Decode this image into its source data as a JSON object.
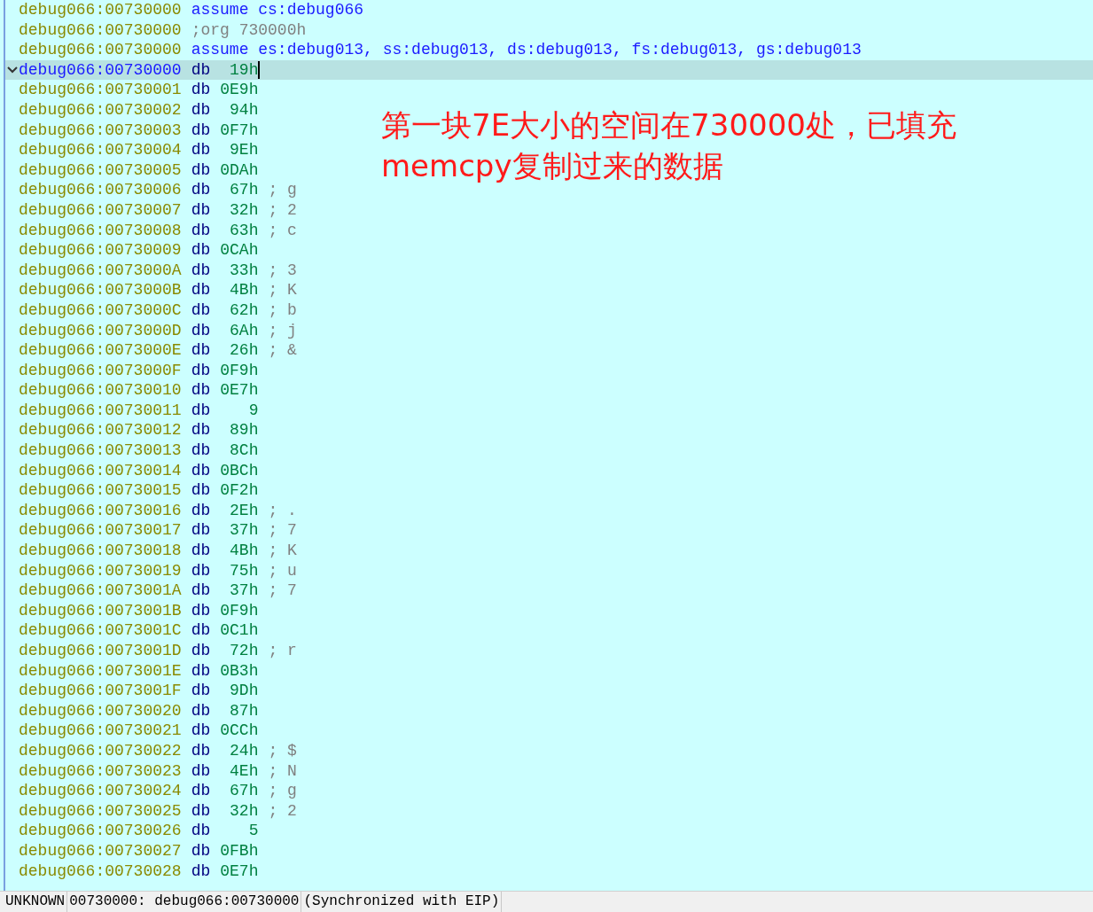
{
  "listing": [
    {
      "kind": "directive",
      "address": "debug066:00730000",
      "text": "assume cs:debug066"
    },
    {
      "kind": "comment",
      "address": "debug066:00730000",
      "text": ";org 730000h"
    },
    {
      "kind": "directive",
      "address": "debug066:00730000",
      "text": "assume es:debug013, ss:debug013, ds:debug013, fs:debug013, gs:debug013"
    },
    {
      "kind": "data",
      "address": "debug066:00730000",
      "mnemonic": "db",
      "value": "19h",
      "selected": true
    },
    {
      "kind": "data",
      "address": "debug066:00730001",
      "mnemonic": "db",
      "value": "0E9h",
      "selected": false
    },
    {
      "kind": "data",
      "address": "debug066:00730002",
      "mnemonic": "db",
      "value": "94h",
      "selected": false
    },
    {
      "kind": "data",
      "address": "debug066:00730003",
      "mnemonic": "db",
      "value": "0F7h",
      "selected": false
    },
    {
      "kind": "data",
      "address": "debug066:00730004",
      "mnemonic": "db",
      "value": "9Eh",
      "selected": false
    },
    {
      "kind": "data",
      "address": "debug066:00730005",
      "mnemonic": "db",
      "value": "0DAh",
      "selected": false
    },
    {
      "kind": "data",
      "address": "debug066:00730006",
      "mnemonic": "db",
      "value": "67h",
      "comment": "; g",
      "selected": false
    },
    {
      "kind": "data",
      "address": "debug066:00730007",
      "mnemonic": "db",
      "value": "32h",
      "comment": "; 2",
      "selected": false
    },
    {
      "kind": "data",
      "address": "debug066:00730008",
      "mnemonic": "db",
      "value": "63h",
      "comment": "; c",
      "selected": false
    },
    {
      "kind": "data",
      "address": "debug066:00730009",
      "mnemonic": "db",
      "value": "0CAh",
      "selected": false
    },
    {
      "kind": "data",
      "address": "debug066:0073000A",
      "mnemonic": "db",
      "value": "33h",
      "comment": "; 3",
      "selected": false
    },
    {
      "kind": "data",
      "address": "debug066:0073000B",
      "mnemonic": "db",
      "value": "4Bh",
      "comment": "; K",
      "selected": false
    },
    {
      "kind": "data",
      "address": "debug066:0073000C",
      "mnemonic": "db",
      "value": "62h",
      "comment": "; b",
      "selected": false
    },
    {
      "kind": "data",
      "address": "debug066:0073000D",
      "mnemonic": "db",
      "value": "6Ah",
      "comment": "; j",
      "selected": false
    },
    {
      "kind": "data",
      "address": "debug066:0073000E",
      "mnemonic": "db",
      "value": "26h",
      "comment": "; &",
      "selected": false
    },
    {
      "kind": "data",
      "address": "debug066:0073000F",
      "mnemonic": "db",
      "value": "0F9h",
      "selected": false
    },
    {
      "kind": "data",
      "address": "debug066:00730010",
      "mnemonic": "db",
      "value": "0E7h",
      "selected": false
    },
    {
      "kind": "data",
      "address": "debug066:00730011",
      "mnemonic": "db",
      "value": "9",
      "selected": false
    },
    {
      "kind": "data",
      "address": "debug066:00730012",
      "mnemonic": "db",
      "value": "89h",
      "selected": false
    },
    {
      "kind": "data",
      "address": "debug066:00730013",
      "mnemonic": "db",
      "value": "8Ch",
      "selected": false
    },
    {
      "kind": "data",
      "address": "debug066:00730014",
      "mnemonic": "db",
      "value": "0BCh",
      "selected": false
    },
    {
      "kind": "data",
      "address": "debug066:00730015",
      "mnemonic": "db",
      "value": "0F2h",
      "selected": false
    },
    {
      "kind": "data",
      "address": "debug066:00730016",
      "mnemonic": "db",
      "value": "2Eh",
      "comment": "; .",
      "selected": false
    },
    {
      "kind": "data",
      "address": "debug066:00730017",
      "mnemonic": "db",
      "value": "37h",
      "comment": "; 7",
      "selected": false
    },
    {
      "kind": "data",
      "address": "debug066:00730018",
      "mnemonic": "db",
      "value": "4Bh",
      "comment": "; K",
      "selected": false
    },
    {
      "kind": "data",
      "address": "debug066:00730019",
      "mnemonic": "db",
      "value": "75h",
      "comment": "; u",
      "selected": false
    },
    {
      "kind": "data",
      "address": "debug066:0073001A",
      "mnemonic": "db",
      "value": "37h",
      "comment": "; 7",
      "selected": false
    },
    {
      "kind": "data",
      "address": "debug066:0073001B",
      "mnemonic": "db",
      "value": "0F9h",
      "selected": false
    },
    {
      "kind": "data",
      "address": "debug066:0073001C",
      "mnemonic": "db",
      "value": "0C1h",
      "selected": false
    },
    {
      "kind": "data",
      "address": "debug066:0073001D",
      "mnemonic": "db",
      "value": "72h",
      "comment": "; r",
      "selected": false
    },
    {
      "kind": "data",
      "address": "debug066:0073001E",
      "mnemonic": "db",
      "value": "0B3h",
      "selected": false
    },
    {
      "kind": "data",
      "address": "debug066:0073001F",
      "mnemonic": "db",
      "value": "9Dh",
      "selected": false
    },
    {
      "kind": "data",
      "address": "debug066:00730020",
      "mnemonic": "db",
      "value": "87h",
      "selected": false
    },
    {
      "kind": "data",
      "address": "debug066:00730021",
      "mnemonic": "db",
      "value": "0CCh",
      "selected": false
    },
    {
      "kind": "data",
      "address": "debug066:00730022",
      "mnemonic": "db",
      "value": "24h",
      "comment": "; $",
      "selected": false
    },
    {
      "kind": "data",
      "address": "debug066:00730023",
      "mnemonic": "db",
      "value": "4Eh",
      "comment": "; N",
      "selected": false
    },
    {
      "kind": "data",
      "address": "debug066:00730024",
      "mnemonic": "db",
      "value": "67h",
      "comment": "; g",
      "selected": false
    },
    {
      "kind": "data",
      "address": "debug066:00730025",
      "mnemonic": "db",
      "value": "32h",
      "comment": "; 2",
      "selected": false
    },
    {
      "kind": "data",
      "address": "debug066:00730026",
      "mnemonic": "db",
      "value": "5",
      "selected": false
    },
    {
      "kind": "data",
      "address": "debug066:00730027",
      "mnemonic": "db",
      "value": "0FBh",
      "selected": false
    },
    {
      "kind": "data",
      "address": "debug066:00730028",
      "mnemonic": "db",
      "value": "0E7h",
      "selected": false
    }
  ],
  "annotation": [
    "第一块7E大小的空间在730000处，已填充",
    "memcpy复制过来的数据"
  ],
  "status_bar": [
    "UNKNOWN",
    "00730000: debug066:00730000",
    "(Synchronized with EIP)"
  ]
}
